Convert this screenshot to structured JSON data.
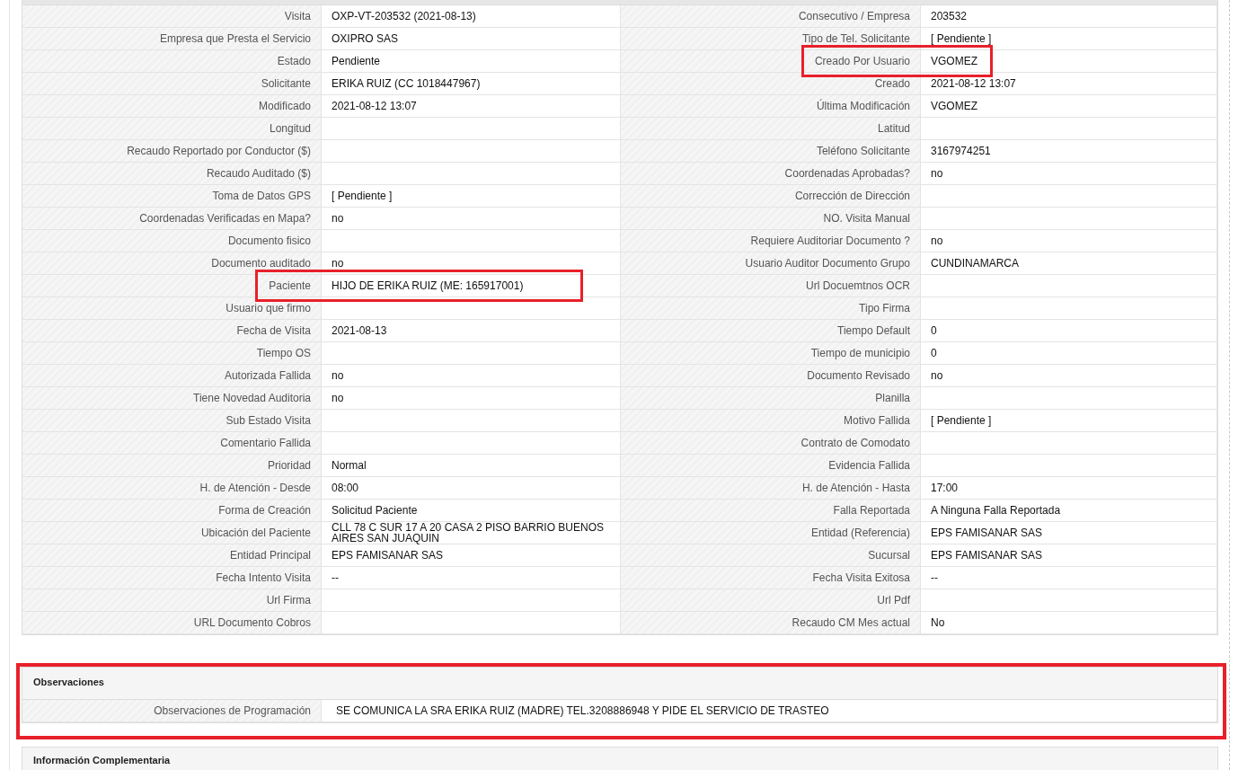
{
  "details": {
    "rows": [
      {
        "left": {
          "label": "Visita",
          "value": "OXP-VT-203532 (2021-08-13)",
          "highlighted": false
        },
        "right": {
          "label": "Consecutivo / Empresa",
          "value": "203532",
          "highlighted": false
        }
      },
      {
        "left": {
          "label": "Empresa que Presta el Servicio",
          "value": "OXIPRO SAS",
          "highlighted": false
        },
        "right": {
          "label": "Tipo de Tel. Solicitante",
          "value": "[ Pendiente ]",
          "highlighted": false
        }
      },
      {
        "left": {
          "label": "Estado",
          "value": "Pendiente",
          "highlighted": false
        },
        "right": {
          "label": "Creado Por Usuario",
          "value": "VGOMEZ",
          "highlighted": true
        }
      },
      {
        "left": {
          "label": "Solicitante",
          "value": "ERIKA RUIZ (CC 1018447967)",
          "highlighted": false
        },
        "right": {
          "label": "Creado",
          "value": "2021-08-12 13:07",
          "highlighted": false
        }
      },
      {
        "left": {
          "label": "Modificado",
          "value": "2021-08-12 13:07",
          "highlighted": false
        },
        "right": {
          "label": "Última Modificación",
          "value": "VGOMEZ",
          "highlighted": false
        }
      },
      {
        "left": {
          "label": "Longitud",
          "highlighted": false
        },
        "right": {
          "label": "Latitud",
          "highlighted": false
        }
      },
      {
        "left": {
          "label": "Recaudo Reportado por Conductor ($)",
          "highlighted": false
        },
        "right": {
          "label": "Teléfono Solicitante",
          "value": "3167974251",
          "highlighted": false
        }
      },
      {
        "left": {
          "label": "Recaudo Auditado ($)",
          "highlighted": false
        },
        "right": {
          "label": "Coordenadas Aprobadas?",
          "value": "no",
          "highlighted": false
        }
      },
      {
        "left": {
          "label": "Toma de Datos GPS",
          "value": "[ Pendiente ]",
          "highlighted": false
        },
        "right": {
          "label": "Corrección de Dirección",
          "highlighted": false
        }
      },
      {
        "left": {
          "label": "Coordenadas Verificadas en Mapa?",
          "value": "no",
          "highlighted": false
        },
        "right": {
          "label": "NO. Visita Manual",
          "highlighted": false
        }
      },
      {
        "left": {
          "label": "Documento fisico",
          "highlighted": false
        },
        "right": {
          "label": "Requiere Auditoriar Documento ?",
          "value": "no",
          "highlighted": false
        }
      },
      {
        "left": {
          "label": "Documento auditado",
          "value": "no",
          "highlighted": false
        },
        "right": {
          "label": "Usuario Auditor Documento Grupo",
          "value": "CUNDINAMARCA",
          "highlighted": false
        }
      },
      {
        "left": {
          "label": "Paciente",
          "value": "HIJO DE ERIKA RUIZ (ME: 165917001)",
          "highlighted": true
        },
        "right": {
          "label": "Url Docuemtnos OCR",
          "highlighted": false
        }
      },
      {
        "left": {
          "label": "Usuario que firmo",
          "highlighted": false
        },
        "right": {
          "label": "Tipo Firma",
          "highlighted": false
        }
      },
      {
        "left": {
          "label": "Fecha de Visita",
          "value": "2021-08-13",
          "highlighted": false
        },
        "right": {
          "label": "Tiempo Default",
          "value": "0",
          "highlighted": false
        }
      },
      {
        "left": {
          "label": "Tiempo OS",
          "highlighted": false
        },
        "right": {
          "label": "Tiempo de municipio",
          "value": "0",
          "highlighted": false
        }
      },
      {
        "left": {
          "label": "Autorizada Fallida",
          "value": "no",
          "highlighted": false
        },
        "right": {
          "label": "Documento Revisado",
          "value": "no",
          "highlighted": false
        }
      },
      {
        "left": {
          "label": "Tiene Novedad Auditoria",
          "value": "no",
          "highlighted": false
        },
        "right": {
          "label": "Planilla",
          "highlighted": false
        }
      },
      {
        "left": {
          "label": "Sub Estado Visita",
          "highlighted": false
        },
        "right": {
          "label": "Motivo Fallida",
          "value": "[ Pendiente ]",
          "highlighted": false
        }
      },
      {
        "left": {
          "label": "Comentario Fallida",
          "highlighted": false
        },
        "right": {
          "label": "Contrato de Comodato",
          "highlighted": false
        }
      },
      {
        "left": {
          "label": "Prioridad",
          "value": "Normal",
          "highlighted": false
        },
        "right": {
          "label": "Evidencia Fallida",
          "highlighted": false
        }
      },
      {
        "left": {
          "label": "H. de Atención - Desde",
          "value": "08:00",
          "highlighted": false
        },
        "right": {
          "label": "H. de Atención - Hasta",
          "value": "17:00",
          "highlighted": false
        }
      },
      {
        "left": {
          "label": "Forma de Creación",
          "value": "Solicitud Paciente",
          "highlighted": false
        },
        "right": {
          "label": "Falla Reportada",
          "value": "A Ninguna Falla Reportada",
          "highlighted": false
        }
      },
      {
        "left": {
          "label": "Ubicación del Paciente",
          "value": "CLL 78 C SUR 17 A 20 CASA 2 PISO BARRIO BUENOS AIRES SAN JUAQUIN",
          "highlighted": false
        },
        "right": {
          "label": "Entidad (Referencia)",
          "value": "EPS FAMISANAR SAS",
          "highlighted": false
        }
      },
      {
        "left": {
          "label": "Entidad Principal",
          "value": "EPS FAMISANAR SAS",
          "highlighted": false
        },
        "right": {
          "label": "Sucursal",
          "value": "EPS FAMISANAR SAS",
          "highlighted": false
        }
      },
      {
        "left": {
          "label": "Fecha Intento Visita",
          "value": "--",
          "highlighted": false
        },
        "right": {
          "label": "Fecha Visita Exitosa",
          "value": "--",
          "highlighted": false
        }
      },
      {
        "left": {
          "label": "Url Firma",
          "highlighted": false
        },
        "right": {
          "label": "Url Pdf",
          "highlighted": false
        }
      },
      {
        "left": {
          "label": "URL Documento Cobros",
          "highlighted": false
        },
        "right": {
          "label": "Recaudo CM Mes actual",
          "value": "No",
          "highlighted": false
        }
      }
    ]
  },
  "observaciones": {
    "title": "Observaciones",
    "highlighted": true,
    "rows": [
      {
        "label": "Observaciones de Programación",
        "value": "SE COMUNICA LA SRA ERIKA RUIZ (MADRE) TEL.3208886948 Y PIDE EL SERVICIO DE TRASTEO"
      }
    ]
  },
  "informacion_complementaria": {
    "title": "Información Complementaria"
  }
}
